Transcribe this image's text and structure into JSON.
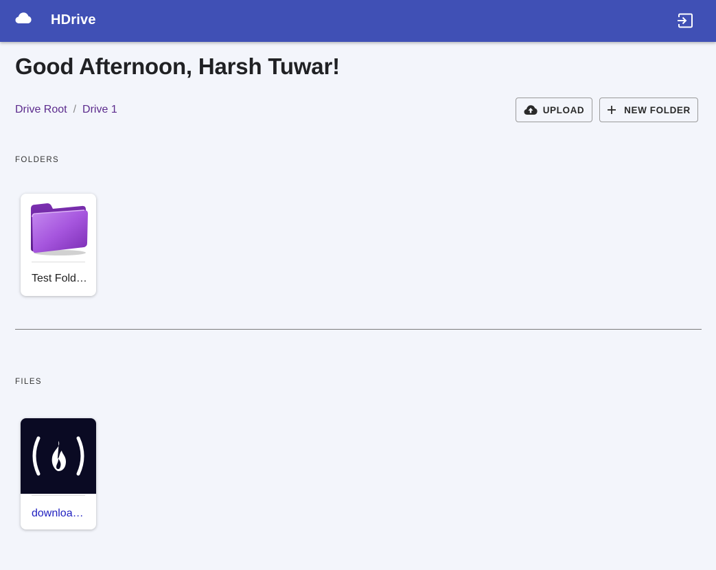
{
  "appbar": {
    "title": "HDrive",
    "logo_icon": "cloud-icon",
    "logout_icon": "logout-icon",
    "color": "#4050b5"
  },
  "greeting": "Good Afternoon, Harsh Tuwar!",
  "breadcrumb": {
    "items": [
      "Drive Root",
      "Drive 1"
    ],
    "separator": "/"
  },
  "toolbar": {
    "upload_label": "UPLOAD",
    "upload_icon": "cloud-upload-icon",
    "new_folder_label": "NEW FOLDER",
    "new_folder_icon": "plus-icon"
  },
  "sections": {
    "folders_label": "FOLDERS",
    "files_label": "FILES"
  },
  "folders": [
    {
      "name": "Test Fold…",
      "icon": "folder-icon"
    }
  ],
  "files": [
    {
      "name": "downloa…",
      "thumbnail": "freecodecamp-logo-icon"
    }
  ]
}
